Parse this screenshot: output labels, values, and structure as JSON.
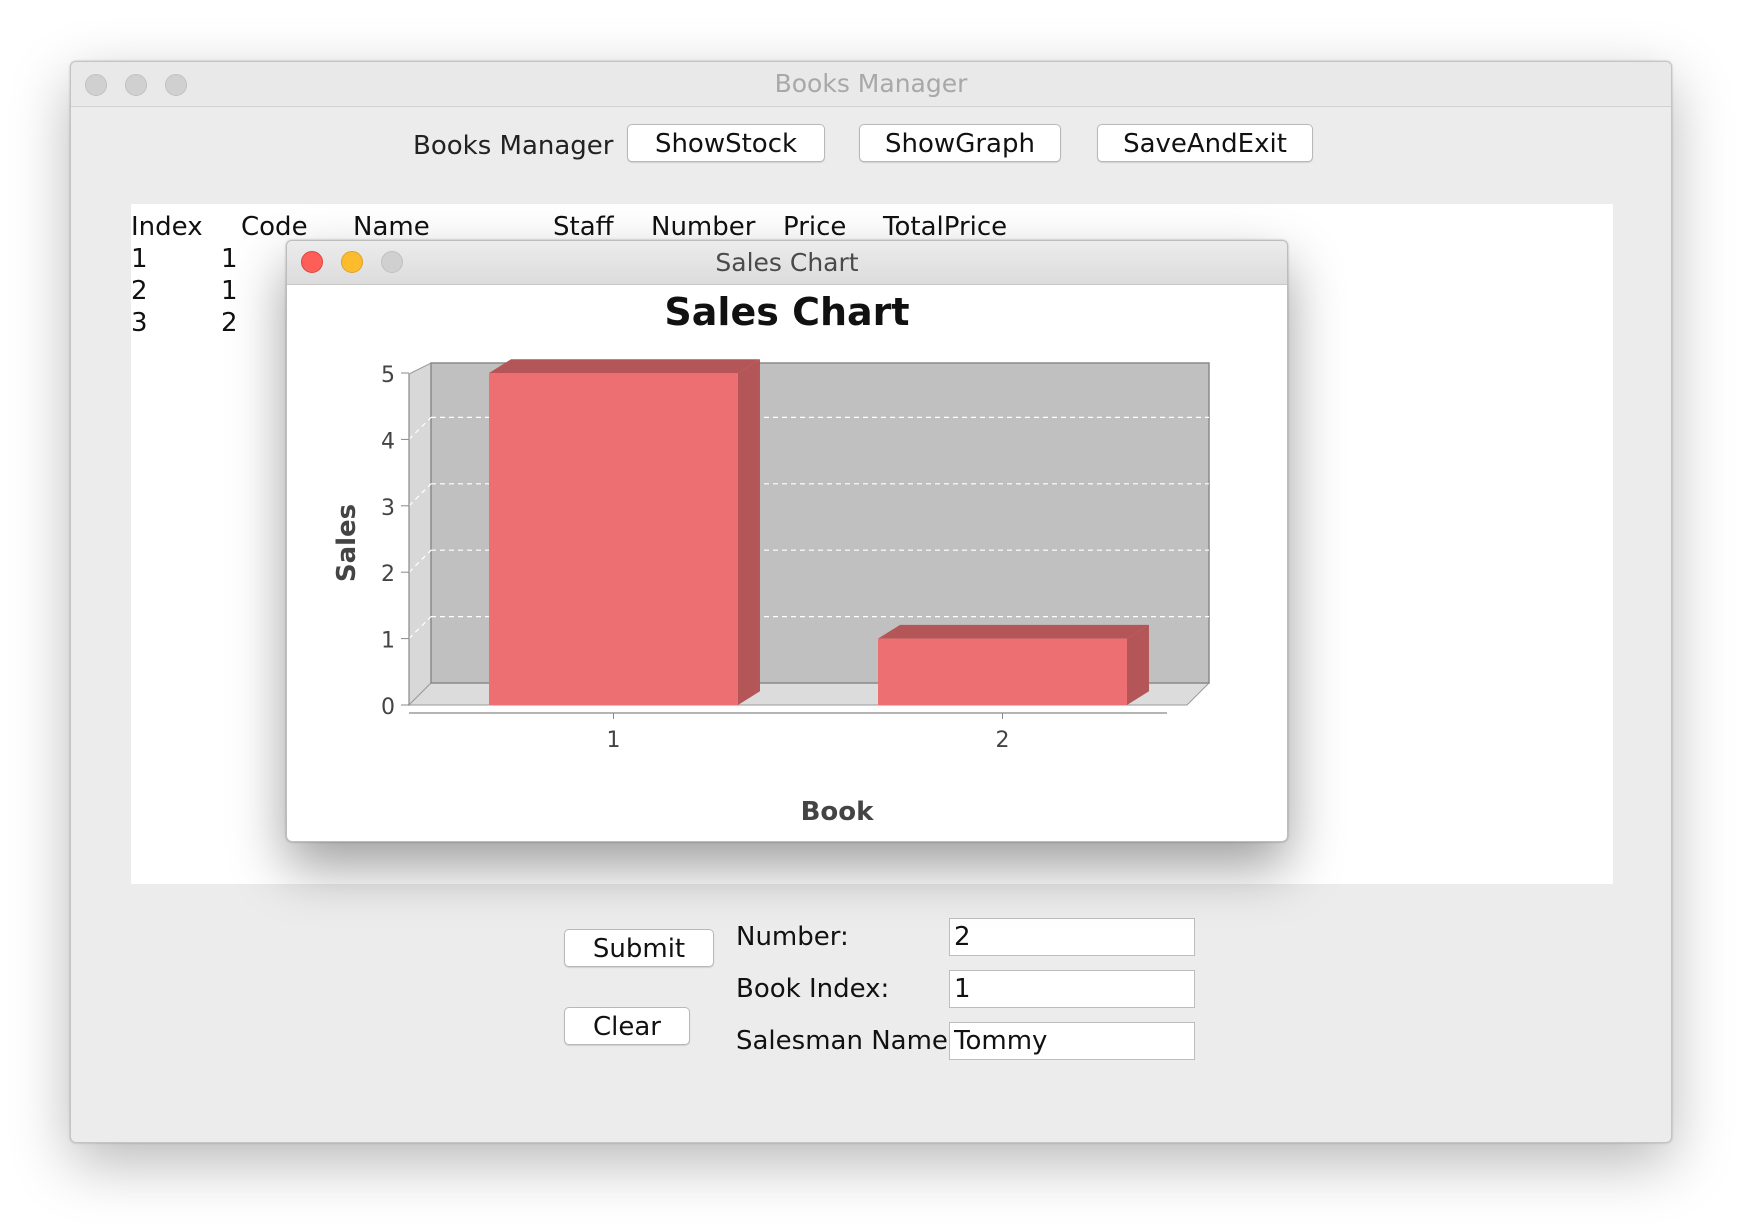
{
  "window": {
    "title": "Books Manager"
  },
  "toolbar": {
    "label": "Books Manager",
    "show_stock": "ShowStock",
    "show_graph": "ShowGraph",
    "save_and_exit": "SaveAndExit"
  },
  "table": {
    "headers": [
      "Index",
      "Code",
      "Name",
      "Staff",
      "Number",
      "Price",
      "TotalPrice"
    ],
    "rows": [
      {
        "index": "1",
        "code": "1"
      },
      {
        "index": "2",
        "code": "1"
      },
      {
        "index": "3",
        "code": "2"
      }
    ]
  },
  "chart_window": {
    "title": "Sales Chart"
  },
  "chart_data": {
    "type": "bar",
    "title": "Sales Chart",
    "xlabel": "Book",
    "ylabel": "Sales",
    "categories": [
      "1",
      "2"
    ],
    "values": [
      5,
      1
    ],
    "ylim": [
      0,
      5
    ],
    "yticks": [
      0,
      1,
      2,
      3,
      4,
      5
    ],
    "grid": true,
    "style": "3d",
    "bar_color": "#ee6f72",
    "bar_side_color": "#b45557",
    "plot_background": "#c0c0c0"
  },
  "form": {
    "submit": "Submit",
    "clear": "Clear",
    "number_label": "Number:",
    "number_value": "2",
    "book_index_label": "Book Index:",
    "book_index_value": "1",
    "salesman_label": "Salesman Name:",
    "salesman_value": "Tommy"
  }
}
